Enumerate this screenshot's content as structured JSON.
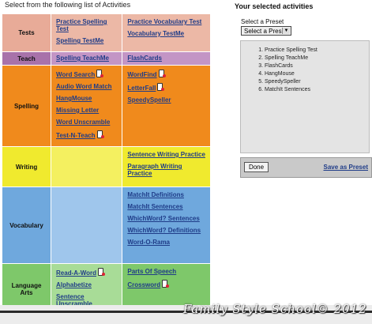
{
  "left": {
    "title": "Select from the following list of Activities"
  },
  "categories": {
    "tests": {
      "label": "Tests",
      "col1": [
        "Practice Spelling Test",
        "Spelling TestMe"
      ],
      "col2": [
        "Practice Vocabulary Test",
        "Vocabulary TestMe"
      ]
    },
    "teach": {
      "label": "Teach",
      "col1": [
        "Spelling TeachMe"
      ],
      "col2": [
        "FlashCards"
      ]
    },
    "spelling": {
      "label": "Spelling",
      "col1": [
        "Word Search",
        "Audio Word Match",
        "HangMouse",
        "Missing Letter",
        "Word Unscramble",
        "Test-N-Teach"
      ],
      "col2": [
        "WordFind",
        "LetterFall",
        "SpeedySpeller"
      ]
    },
    "writing": {
      "label": "Writing",
      "col2": [
        "Sentence Writing Practice",
        "Paragraph Writing Practice"
      ]
    },
    "vocabulary": {
      "label": "Vocabulary",
      "col2": [
        "MatchIt Definitions",
        "MatchIt Sentences",
        "WhichWord? Sentences",
        "WhichWord? Definitions",
        "Word-O-Rama"
      ]
    },
    "language_arts": {
      "label": "Language Arts",
      "col1": [
        "Read-A-Word",
        "Alphabetize",
        "Sentence Unscramble"
      ],
      "col2": [
        "Parts Of Speech",
        "Crossword"
      ]
    }
  },
  "right": {
    "title": "Your selected activities",
    "preset_label": "Select a Preset",
    "preset_value": "Select a Preset",
    "selected": [
      "Practice Spelling Test",
      "Spelling TeachMe",
      "FlashCards",
      "HangMouse",
      "SpeedySpeller",
      "MatchIt Sentences"
    ],
    "done_label": "Done",
    "save_label": "Save as Preset"
  },
  "icons": {
    "mobile": "mobile-phone-icon"
  },
  "watermark": "Family Style School© 2012",
  "colors": {
    "tests": "#e8ab98",
    "teach": "#a872aa",
    "spelling": "#f08a1c",
    "writing": "#f0ea2e",
    "vocabulary": "#6fa8dd",
    "language_arts": "#7ec86a",
    "link": "#1f3c88"
  }
}
